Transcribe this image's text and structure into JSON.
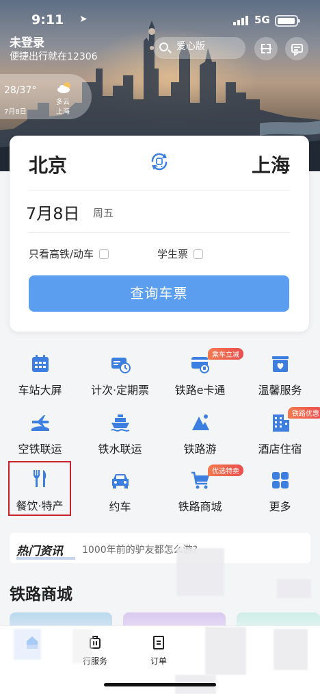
{
  "status_bar": {
    "time": "9:11",
    "network": "5G"
  },
  "header": {
    "login_title": "未登录",
    "login_subtitle": "便捷出行就在12306",
    "search_placeholder": "爱心版",
    "icons": [
      "scan-icon",
      "message-icon",
      "search-icon"
    ]
  },
  "weather": {
    "temperature": "28/37°",
    "date": "7月8日",
    "condition": "多云",
    "city": "上海"
  },
  "ticket_search": {
    "from_station": "北京",
    "to_station": "上海",
    "date": "7月8日",
    "weekday": "周五",
    "option_high_speed": "只看高铁/动车",
    "option_student": "学生票",
    "query_button": "查询车票"
  },
  "services": [
    {
      "label": "车站大屏",
      "icon": "station-screen-icon"
    },
    {
      "label": "计次·定期票",
      "icon": "ticket-card-icon"
    },
    {
      "label": "铁路e卡通",
      "icon": "e-card-icon",
      "badge": "乘车立减"
    },
    {
      "label": "温馨服务",
      "icon": "warm-service-icon"
    },
    {
      "label": "空铁联运",
      "icon": "air-rail-icon"
    },
    {
      "label": "铁水联运",
      "icon": "rail-ship-icon"
    },
    {
      "label": "铁路游",
      "icon": "rail-tour-icon"
    },
    {
      "label": "酒店住宿",
      "icon": "hotel-icon",
      "badge": "铁路优惠"
    },
    {
      "label": "餐饮·特产",
      "icon": "dining-icon"
    },
    {
      "label": "约车",
      "icon": "car-icon"
    },
    {
      "label": "铁路商城",
      "icon": "shopping-cart-icon",
      "badge": "优选特卖"
    },
    {
      "label": "更多",
      "icon": "more-grid-icon"
    }
  ],
  "news": {
    "tag": "热门资讯",
    "headline": "1000年前的驴友都怎么游?"
  },
  "mall": {
    "title": "铁路商城"
  },
  "tabbar": [
    {
      "label": "",
      "icon": "home-icon"
    },
    {
      "label": "行服务",
      "icon": "luggage-icon"
    },
    {
      "label": "订单",
      "icon": "order-icon"
    },
    {
      "label": "",
      "icon": "blurred-icon"
    },
    {
      "label": "",
      "icon": "blurred-icon"
    }
  ],
  "colors": {
    "accent": "#5b9ef0",
    "icon_blue": "#3d7fe0",
    "badge_red": "#ea4d4d",
    "highlight_border": "#c8232c"
  }
}
